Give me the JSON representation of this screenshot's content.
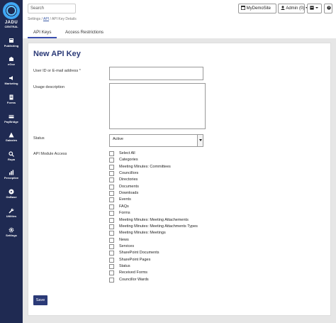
{
  "brand": {
    "name": "JADU",
    "sub": "CENTRAL"
  },
  "sidebar": {
    "items": [
      {
        "label": "Publishing",
        "icon": "publishing-icon"
      },
      {
        "label": "eGov",
        "icon": "egov-icon"
      },
      {
        "label": "Marketing",
        "icon": "marketing-icon"
      },
      {
        "label": "Forms",
        "icon": "forms-icon"
      },
      {
        "label": "PayBridge",
        "icon": "paybridge-icon"
      },
      {
        "label": "Galaxies",
        "icon": "galaxies-icon"
      },
      {
        "label": "Rupa",
        "icon": "rupa-icon"
      },
      {
        "label": "Perceptive",
        "icon": "perceptive-icon"
      },
      {
        "label": "OnBase",
        "icon": "onbase-icon"
      },
      {
        "label": "Utilities",
        "icon": "utilities-icon"
      },
      {
        "label": "Settings",
        "icon": "settings-icon"
      }
    ]
  },
  "header": {
    "search_placeholder": "Search",
    "breadcrumb": {
      "root": "Settings",
      "sep": "/",
      "api": "API",
      "current": "API Key Details"
    },
    "site_button": "MyDemoSite",
    "admin_button": "Admin (0)",
    "tabs": [
      "API Keys",
      "Access Restrictions"
    ]
  },
  "form": {
    "title": "New API Key",
    "user_label": "User ID or E-mail address",
    "required_mark": "*",
    "usage_label": "Usage description",
    "status_label": "Status",
    "status_value": "Active",
    "modules_label": "API Module Access",
    "modules": [
      "Select All",
      "Categories",
      "Meeting Minutes: Committees",
      "Councillors",
      "Directories",
      "Documents",
      "Downloads",
      "Events",
      "FAQs",
      "Forms",
      "Meeting Minutes: Meeting Attachements",
      "Meeting Minutes: Meeting Attachments Types",
      "Meeting Minutes: Meetings",
      "News",
      "Services",
      "SharePoint Documents",
      "SharePoint Pages",
      "Status",
      "Received Forms",
      "Councillor Wards"
    ],
    "save_label": "Save"
  }
}
